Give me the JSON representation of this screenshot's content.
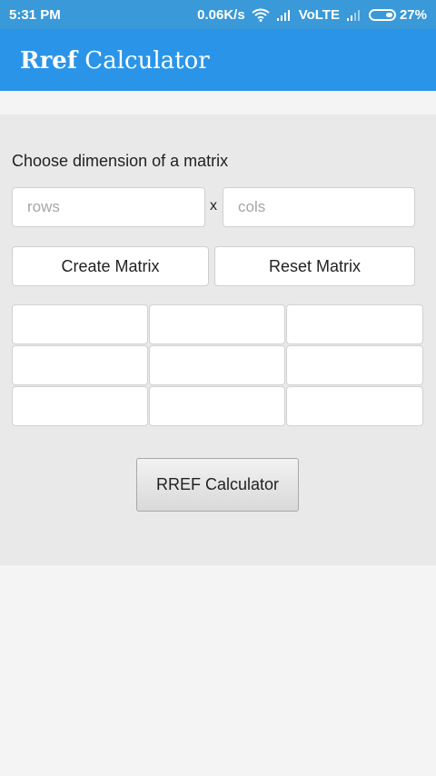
{
  "status_bar": {
    "time": "5:31 PM",
    "net_speed": "0.06K/s",
    "network": "VoLTE",
    "battery": "27%"
  },
  "app_bar": {
    "title_bold": "Rref",
    "title_rest": " Calculator"
  },
  "form": {
    "prompt": "Choose dimension of a matrix",
    "rows_placeholder": "rows",
    "cols_placeholder": "cols",
    "times": "x",
    "create_label": "Create Matrix",
    "reset_label": "Reset Matrix"
  },
  "matrix": {
    "rows": 3,
    "cols": 3
  },
  "calculate_label": "RREF Calculator",
  "colors": {
    "status_bar": "#3a99d8",
    "app_bar": "#2a95e8",
    "content_bg": "#e9e9e9",
    "page_bg": "#f4f4f4"
  },
  "icons": [
    "wifi-icon",
    "signal-icon",
    "battery-icon"
  ]
}
